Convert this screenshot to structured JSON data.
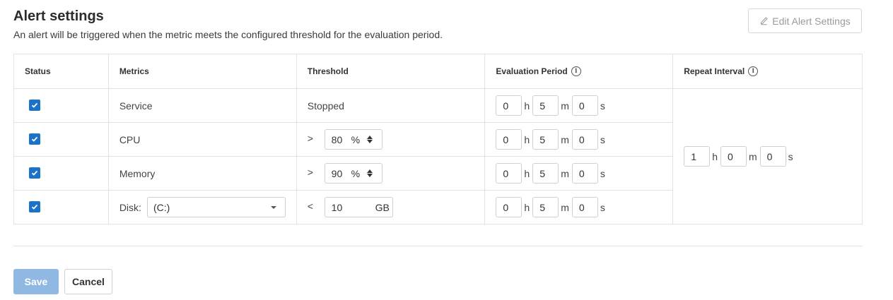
{
  "header": {
    "title": "Alert settings",
    "subtitle": "An alert will be triggered when the metric meets the configured threshold for the evaluation period.",
    "edit_button_label": "Edit Alert Settings",
    "edit_icon": "pencil-icon"
  },
  "columns": {
    "status": "Status",
    "metrics": "Metrics",
    "threshold": "Threshold",
    "evaluation_period": "Evaluation Period",
    "repeat_interval": "Repeat Interval",
    "info_icon": "info-icon"
  },
  "units": {
    "h": "h",
    "m": "m",
    "s": "s"
  },
  "rows": [
    {
      "checked": true,
      "metric": "Service",
      "threshold_text": "Stopped",
      "eval": {
        "h": "0",
        "m": "5",
        "s": "0"
      }
    },
    {
      "checked": true,
      "metric": "CPU",
      "operator": ">",
      "threshold_value": "80",
      "threshold_unit": "%",
      "eval": {
        "h": "0",
        "m": "5",
        "s": "0"
      }
    },
    {
      "checked": true,
      "metric": "Memory",
      "operator": ">",
      "threshold_value": "90",
      "threshold_unit": "%",
      "eval": {
        "h": "0",
        "m": "5",
        "s": "0"
      }
    },
    {
      "checked": true,
      "metric": "Disk:",
      "disk_selected": "(C:)",
      "operator": "<",
      "threshold_value": "10",
      "threshold_unit": "GB",
      "eval": {
        "h": "0",
        "m": "5",
        "s": "0"
      }
    }
  ],
  "repeat": {
    "h": "1",
    "m": "0",
    "s": "0"
  },
  "footer": {
    "save_label": "Save",
    "cancel_label": "Cancel"
  },
  "colors": {
    "accent": "#1a73c9",
    "save_disabled": "#8fb8e3",
    "border": "#e2e2e2"
  }
}
